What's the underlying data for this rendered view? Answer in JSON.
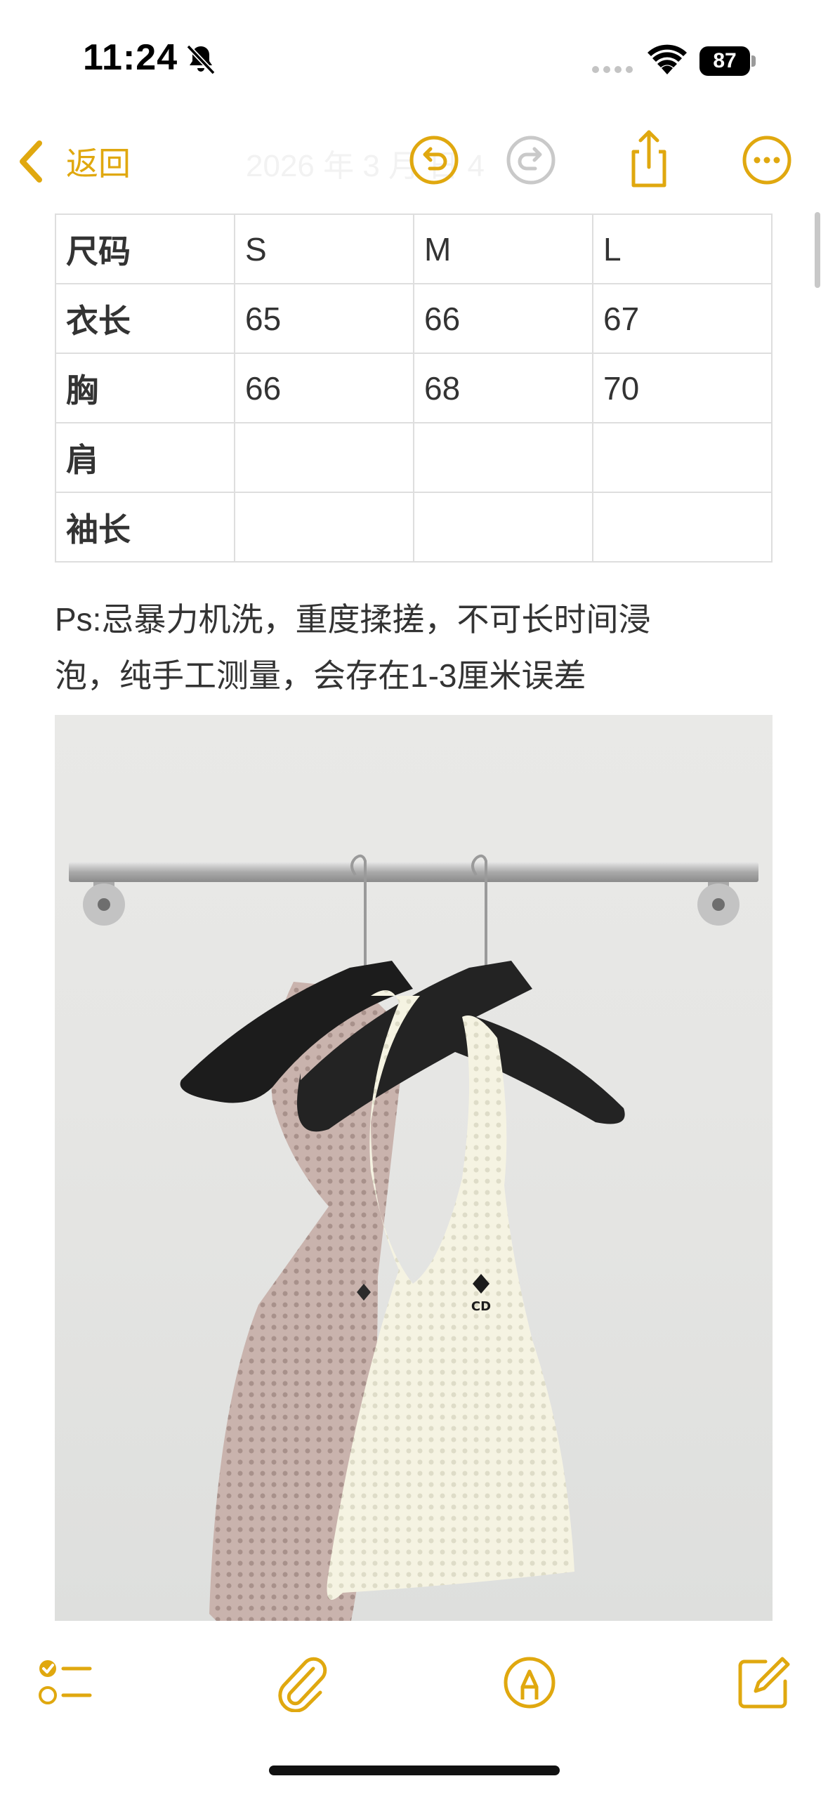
{
  "status_bar": {
    "time": "11:24",
    "battery_level": "87",
    "icons": [
      "bell-slash-icon",
      "cellular-signal-icon",
      "wifi-icon",
      "battery-icon"
    ]
  },
  "nav": {
    "back_label": "返回",
    "title": "2026 年 3 月 日 4",
    "accent_color": "#e0a80f",
    "icons": [
      "chevron-left-icon",
      "undo-icon",
      "redo-icon",
      "share-icon",
      "more-icon"
    ]
  },
  "table": {
    "header": [
      "尺码",
      "S",
      "M",
      "L"
    ],
    "rows": [
      [
        "衣长",
        "65",
        "66",
        "67"
      ],
      [
        "胸",
        "66",
        "68",
        "70"
      ],
      [
        "肩",
        "",
        "",
        ""
      ],
      [
        "袖长",
        "",
        "",
        ""
      ]
    ]
  },
  "note": {
    "line1": "Ps:忌暴力机洗，重度揉搓，不可长时间浸",
    "line2": "泡，纯手工测量，会存在1-3厘米误差"
  },
  "photo": {
    "logo_text": "CD"
  },
  "toolbar": {
    "icons": [
      "checklist-icon",
      "paperclip-icon",
      "markup-pen-icon",
      "compose-icon"
    ]
  }
}
